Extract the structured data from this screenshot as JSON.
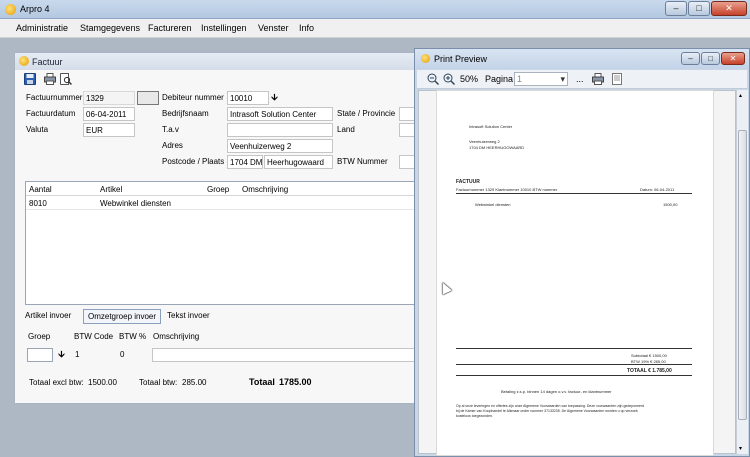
{
  "app": {
    "title": "Arpro 4"
  },
  "menu": [
    "Administratie",
    "Stamgegevens",
    "Factureren",
    "Instellingen",
    "Venster",
    "Info"
  ],
  "factuur": {
    "title": "Factuur",
    "labels": {
      "factuurnummer": "Factuurnummer",
      "factuurdatum": "Factuurdatum",
      "valuta": "Valuta",
      "debiteurnummer": "Debiteur nummer",
      "bedrijfsnaam": "Bedrijfsnaam",
      "tav": "T.a.v",
      "adres": "Adres",
      "postcode_plaats": "Postcode / Plaats",
      "state": "State / Provincie",
      "land": "Land",
      "btw_nummer": "BTW Nummer"
    },
    "values": {
      "factuurnummer": "1329",
      "factuurdatum": "06-04-2011",
      "valuta": "EUR",
      "debiteurnummer": "10010",
      "bedrijfsnaam": "Intrasoft Solution Center",
      "tav": "",
      "adres": "Veenhuizerweg 2",
      "postcode": "1704 DM",
      "plaats": "Heerhugowaard"
    },
    "grid": {
      "columns": [
        "Aantal",
        "Artikel",
        "Groep",
        "Omschrijving"
      ],
      "rows": [
        {
          "aantal": "8010",
          "artikel": "Webwinkel diensten",
          "groep": "",
          "omschrijving": ""
        }
      ]
    },
    "tabs": [
      "Artikel invoer",
      "Omzetgroep invoer",
      "Tekst invoer"
    ],
    "omzet": {
      "labels": {
        "groep": "Groep",
        "btw_code": "BTW Code",
        "btw_pct": "BTW %",
        "omschrijving": "Omschrijving"
      },
      "btw_code": "1",
      "btw_pct": "0"
    },
    "totals": {
      "excl_label": "Totaal excl btw:",
      "excl_value": "1500.00",
      "btw_label": "Totaal btw:",
      "btw_value": "285.00",
      "totaal_label": "Totaal",
      "totaal_value": "1785.00"
    }
  },
  "preview": {
    "title": "Print Preview",
    "zoom": "50%",
    "page_label": "Pagina",
    "page_value": "1",
    "ellipsis": "...",
    "doc": {
      "company": "Intrasoft Solution Center",
      "address1": "Veenhuizerweg 2",
      "address2": "1704 DM HEERHUGOWAARD",
      "heading": "FACTUUR",
      "meta_left": "Factuurnummer 1329   Klantnummer 10010   BTW nummer",
      "meta_right": "Datum: 06-04-2011",
      "line_desc": "Webwinkel diensten",
      "line_amount": "1500,00",
      "subtotaal": "Subtotaal   € 1500,00",
      "btw": "BTW 19%   € 285,00",
      "totaal": "TOTAAL        € 1.785,00",
      "payment": "Betaling z.s.p. binnen 14 dagen o.v.v. factuur- en klantnummer",
      "terms1": "Op al onze leveringen en offertes zijn onze Algemene Voorwaarden van toepassing. Deze voorwaarden zijn gedeponeerd",
      "terms2": "bij de Kamer van Koophandel te Alkmaar onder nummer 37133235. De Algemene Voorwaarden worden u op verzoek",
      "terms3": "kosteloos toegezonden."
    }
  },
  "icons": {
    "app": "app-icon",
    "save": "save-icon",
    "print": "print-icon",
    "preview": "print-preview-icon",
    "zoom_out": "zoom-out-icon",
    "zoom_in": "zoom-in-icon"
  }
}
